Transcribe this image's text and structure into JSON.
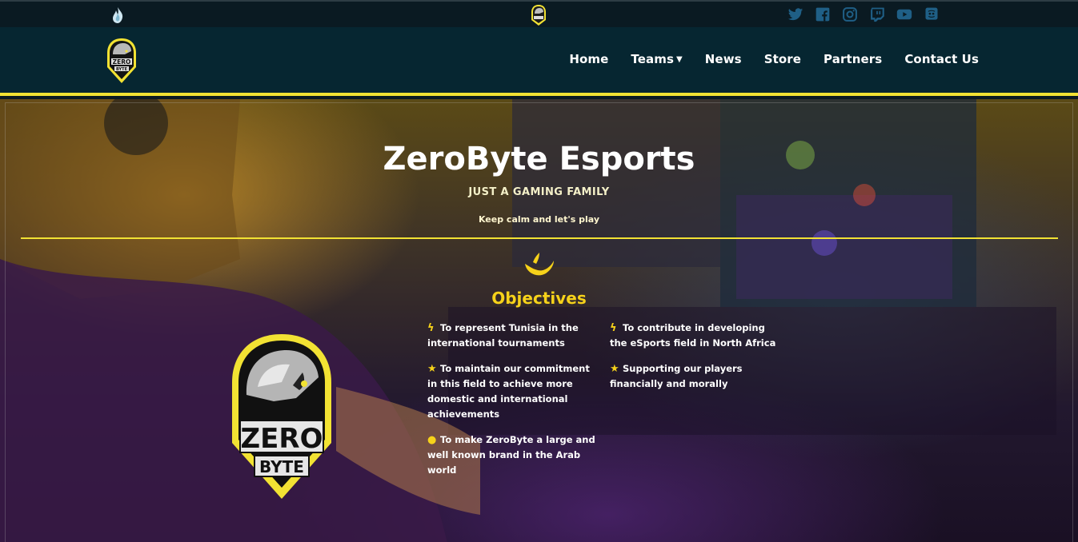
{
  "topbar": {
    "social_icons": [
      "twitter-icon",
      "facebook-icon",
      "instagram-icon",
      "twitch-icon",
      "youtube-icon",
      "discord-icon"
    ]
  },
  "nav": {
    "items": [
      {
        "label": "Home"
      },
      {
        "label": "Teams"
      },
      {
        "label": "News"
      },
      {
        "label": "Store"
      },
      {
        "label": "Partners"
      },
      {
        "label": "Contact Us"
      }
    ]
  },
  "hero": {
    "title": "ZeroByte Esports",
    "subtitle": "JUST A GAMING FAMILY",
    "tagline": "Keep calm and let's play"
  },
  "objectives": {
    "heading": "Objectives",
    "items": [
      {
        "icon": "lightning-icon",
        "text": "To represent Tunisia in the international tournaments"
      },
      {
        "icon": "lightning-icon",
        "text": "To contribute in developing the eSports field in North Africa"
      },
      {
        "icon": "star-icon",
        "text": "To maintain our commitment in this field to achieve more domestic and international achievements"
      },
      {
        "icon": "star-icon",
        "text": "Supporting our players financially and morally"
      },
      {
        "icon": "user-icon",
        "text": "To make ZeroByte a large and well known brand in the Arab world"
      }
    ]
  },
  "logo": {
    "line1": "ZERO",
    "line2": "BYTE"
  },
  "colors": {
    "accent": "#f2e233",
    "nav_bg": "#062631",
    "topbar_bg": "#0a1a22",
    "social": "#1f5f86"
  }
}
